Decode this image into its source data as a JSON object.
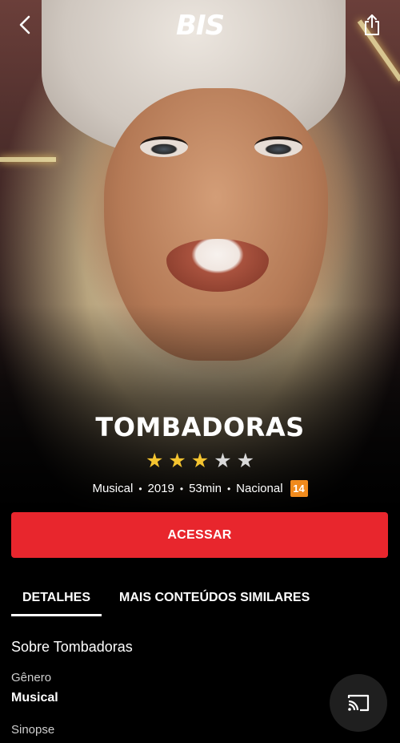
{
  "header": {
    "back_icon": "chevron-left-icon",
    "logo_text": "BIS",
    "share_icon": "share-icon"
  },
  "show": {
    "title": "TOMBADORAS",
    "rating_stars": 3,
    "max_stars": 5,
    "genre": "Musical",
    "year": "2019",
    "duration": "53min",
    "origin": "Nacional",
    "age_rating": "14"
  },
  "colors": {
    "accent": "#e8262d",
    "star_on": "#f4c430",
    "star_off": "#d9d9d9",
    "age_badge": "#f08a1c"
  },
  "cta": {
    "label": "ACESSAR"
  },
  "tabs": [
    {
      "label": "DETALHES",
      "active": true
    },
    {
      "label": "MAIS CONTEÚDOS SIMILARES",
      "active": false
    }
  ],
  "details": {
    "section_title": "Sobre Tombadoras",
    "genre_label": "Gênero",
    "genre_value": "Musical",
    "synopsis_label": "Sinopse"
  },
  "cast": {
    "icon": "cast-icon"
  }
}
